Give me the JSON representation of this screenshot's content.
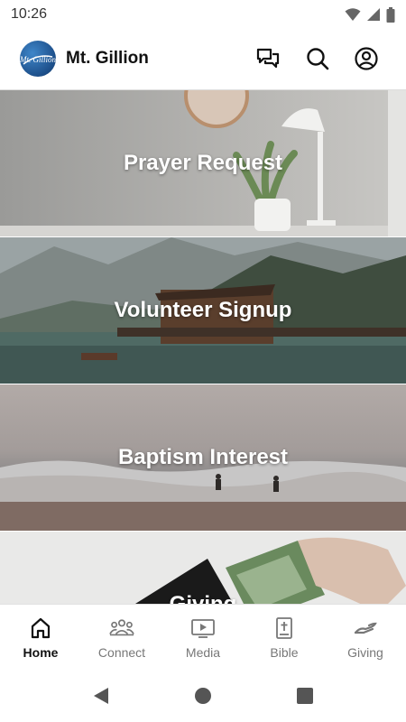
{
  "status_bar": {
    "time": "10:26",
    "icons": [
      "wifi-icon",
      "cellular-signal-icon",
      "battery-icon"
    ]
  },
  "app_bar": {
    "title": "Mt. Gillion",
    "logo_text": "Mt. Gillion",
    "actions": [
      "chat-icon",
      "search-icon",
      "account-icon"
    ]
  },
  "tiles": [
    {
      "label": "Prayer Request"
    },
    {
      "label": "Volunteer Signup"
    },
    {
      "label": "Baptism Interest"
    },
    {
      "label": "Giving"
    }
  ],
  "bottom_nav": {
    "items": [
      {
        "label": "Home",
        "icon": "home-icon",
        "active": true
      },
      {
        "label": "Connect",
        "icon": "group-icon",
        "active": false
      },
      {
        "label": "Media",
        "icon": "video-icon",
        "active": false
      },
      {
        "label": "Bible",
        "icon": "bible-icon",
        "active": false
      },
      {
        "label": "Giving",
        "icon": "giving-icon",
        "active": false
      }
    ]
  },
  "system_nav": [
    "back-icon",
    "home-circle-icon",
    "recents-icon"
  ],
  "colors": {
    "accent": "#111111",
    "inactive": "#777777",
    "logo_blue": "#1d4f8a"
  }
}
